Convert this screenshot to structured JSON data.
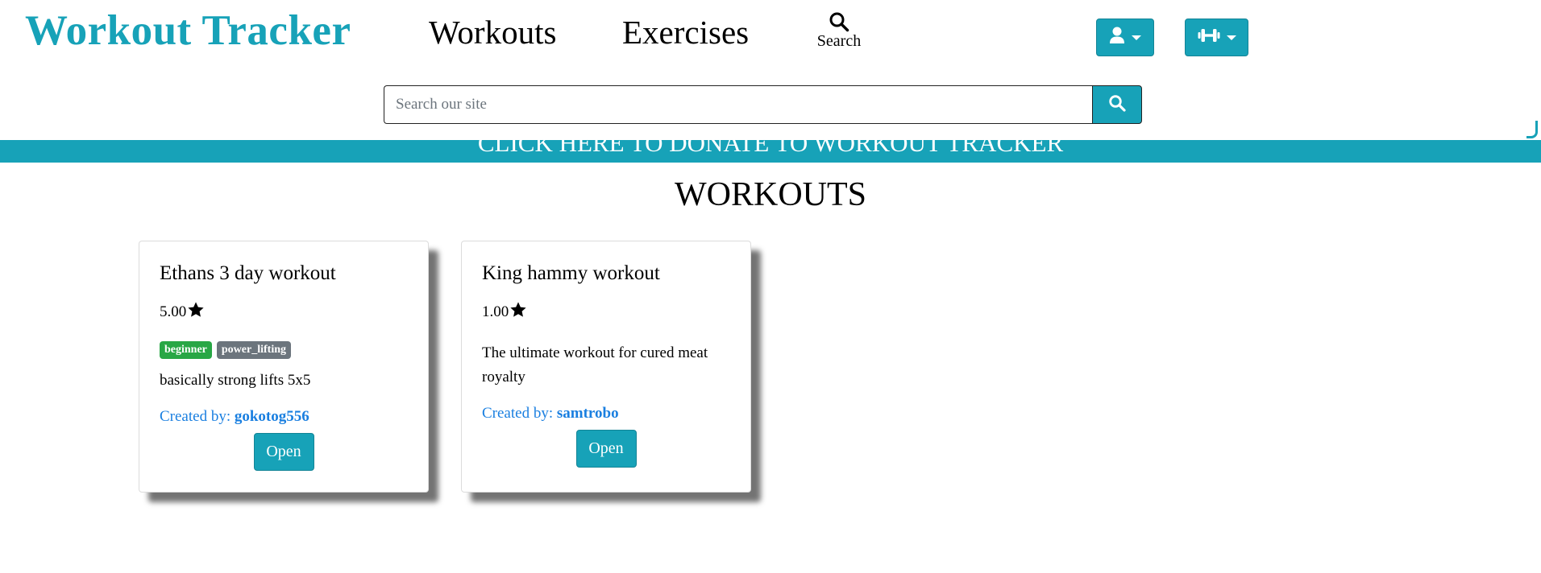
{
  "header": {
    "brand": "Workout Tracker",
    "nav": {
      "workouts": "Workouts",
      "exercises": "Exercises",
      "search": "Search"
    },
    "icons": {
      "search": "search-icon",
      "user_menu": "user-icon",
      "workout_menu": "dumbbell-icon",
      "caret": "caret-down-icon"
    }
  },
  "search": {
    "placeholder": "Search our site",
    "value": ""
  },
  "donate_banner": {
    "text": "CLICK HERE TO DONATE TO WORKOUT TRACKER"
  },
  "page": {
    "title": "WORKOUTS"
  },
  "cards": [
    {
      "title": "Ethans 3 day workout",
      "rating": "5.00",
      "tags": [
        "beginner",
        "power_lifting"
      ],
      "description": "basically strong lifts 5x5",
      "created_by_label": "Created by:",
      "author": "gokotog556",
      "open_label": "Open"
    },
    {
      "title": "King hammy workout",
      "rating": "1.00",
      "tags": [],
      "description": "The ultimate workout for cured meat royalty",
      "created_by_label": "Created by:",
      "author": "samtrobo",
      "open_label": "Open"
    }
  ],
  "colors": {
    "accent": "#17a2b8",
    "link": "#1a7fe0",
    "tag_beginner": "#28a745",
    "tag_power_lifting": "#6c757d"
  }
}
